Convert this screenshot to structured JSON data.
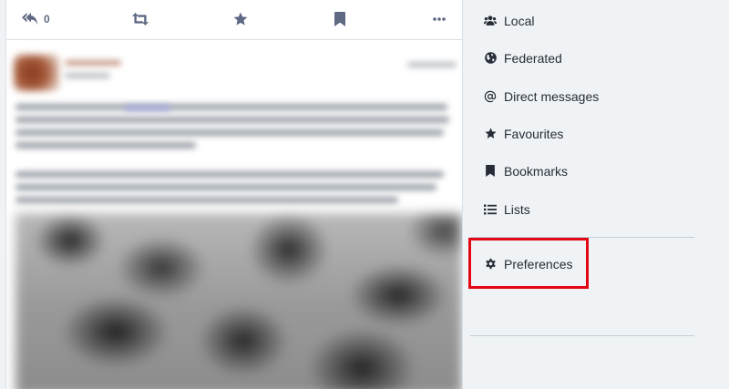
{
  "action_bar": {
    "reply_count": "0",
    "icons": [
      "reply-all-icon",
      "retweet-icon",
      "star-icon",
      "bookmark-icon",
      "ellipsis-icon"
    ]
  },
  "navigation": {
    "items": [
      {
        "label": "Local",
        "icon": "users-icon"
      },
      {
        "label": "Federated",
        "icon": "globe-icon"
      },
      {
        "label": "Direct messages",
        "icon": "at-icon"
      },
      {
        "label": "Favourites",
        "icon": "star-icon"
      },
      {
        "label": "Bookmarks",
        "icon": "bookmark-icon"
      },
      {
        "label": "Lists",
        "icon": "list-icon"
      },
      {
        "label": "Preferences",
        "icon": "cog-icon"
      }
    ]
  },
  "colors": {
    "background": "#eff3f5",
    "text": "#282c37",
    "action_icon": "#606984",
    "highlight": "#e30613"
  }
}
